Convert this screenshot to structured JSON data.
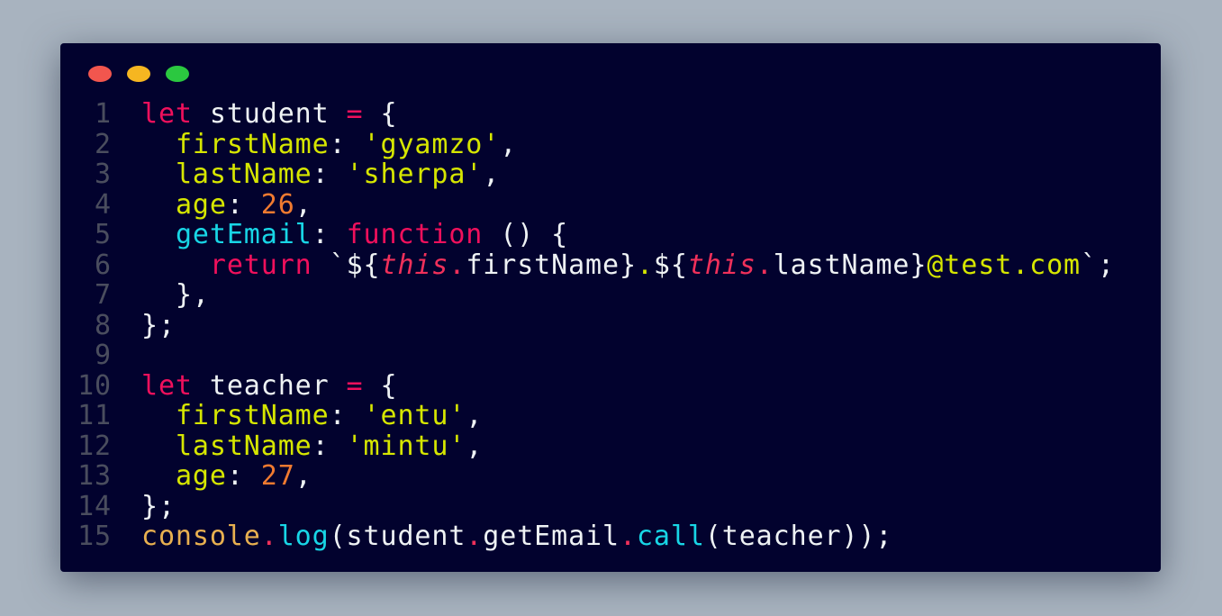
{
  "window_controls": [
    {
      "name": "close",
      "color": "#f2564e"
    },
    {
      "name": "minimize",
      "color": "#f6b621"
    },
    {
      "name": "maximize",
      "color": "#2bc840"
    }
  ],
  "colors": {
    "background": "#a8b3bf",
    "editor_background": "#02022e"
  },
  "code": {
    "lines": [
      [
        [
          "let",
          "kw"
        ],
        [
          " student ",
          "plain"
        ],
        [
          "=",
          "op"
        ],
        [
          " {",
          "plain"
        ]
      ],
      [
        [
          "  ",
          "plain"
        ],
        [
          "firstName",
          "prop"
        ],
        [
          ": ",
          "plain"
        ],
        [
          "'gyamzo'",
          "str"
        ],
        [
          ",",
          "plain"
        ]
      ],
      [
        [
          "  ",
          "plain"
        ],
        [
          "lastName",
          "prop"
        ],
        [
          ": ",
          "plain"
        ],
        [
          "'sherpa'",
          "str"
        ],
        [
          ",",
          "plain"
        ]
      ],
      [
        [
          "  ",
          "plain"
        ],
        [
          "age",
          "prop"
        ],
        [
          ": ",
          "plain"
        ],
        [
          "26",
          "num"
        ],
        [
          ",",
          "plain"
        ]
      ],
      [
        [
          "  ",
          "plain"
        ],
        [
          "getEmail",
          "fn"
        ],
        [
          ": ",
          "plain"
        ],
        [
          "function",
          "kw"
        ],
        [
          " () {",
          "plain"
        ]
      ],
      [
        [
          "    ",
          "plain"
        ],
        [
          "return",
          "kw"
        ],
        [
          " `${",
          "plain"
        ],
        [
          "this",
          "this"
        ],
        [
          ".",
          "dotop"
        ],
        [
          "firstName}",
          "plain"
        ],
        [
          ".",
          "ydot"
        ],
        [
          "${",
          "plain"
        ],
        [
          "this",
          "this"
        ],
        [
          ".",
          "dotop"
        ],
        [
          "lastName}",
          "plain"
        ],
        [
          "@test.com",
          "str"
        ],
        [
          "`;",
          "plain"
        ]
      ],
      [
        [
          "  },",
          "plain"
        ]
      ],
      [
        [
          "};",
          "plain"
        ]
      ],
      [],
      [
        [
          "let",
          "kw"
        ],
        [
          " teacher ",
          "plain"
        ],
        [
          "=",
          "op"
        ],
        [
          " {",
          "plain"
        ]
      ],
      [
        [
          "  ",
          "plain"
        ],
        [
          "firstName",
          "prop"
        ],
        [
          ": ",
          "plain"
        ],
        [
          "'entu'",
          "str"
        ],
        [
          ",",
          "plain"
        ]
      ],
      [
        [
          "  ",
          "plain"
        ],
        [
          "lastName",
          "prop"
        ],
        [
          ": ",
          "plain"
        ],
        [
          "'mintu'",
          "str"
        ],
        [
          ",",
          "plain"
        ]
      ],
      [
        [
          "  ",
          "plain"
        ],
        [
          "age",
          "prop"
        ],
        [
          ": ",
          "plain"
        ],
        [
          "27",
          "num"
        ],
        [
          ",",
          "plain"
        ]
      ],
      [
        [
          "};",
          "plain"
        ]
      ],
      [
        [
          "console",
          "obj"
        ],
        [
          ".",
          "dotop"
        ],
        [
          "log",
          "fn"
        ],
        [
          "(student",
          "plain"
        ],
        [
          ".",
          "dotop"
        ],
        [
          "getEmail",
          "plain"
        ],
        [
          ".",
          "dotop"
        ],
        [
          "call",
          "fn"
        ],
        [
          "(teacher));",
          "plain"
        ]
      ]
    ]
  }
}
